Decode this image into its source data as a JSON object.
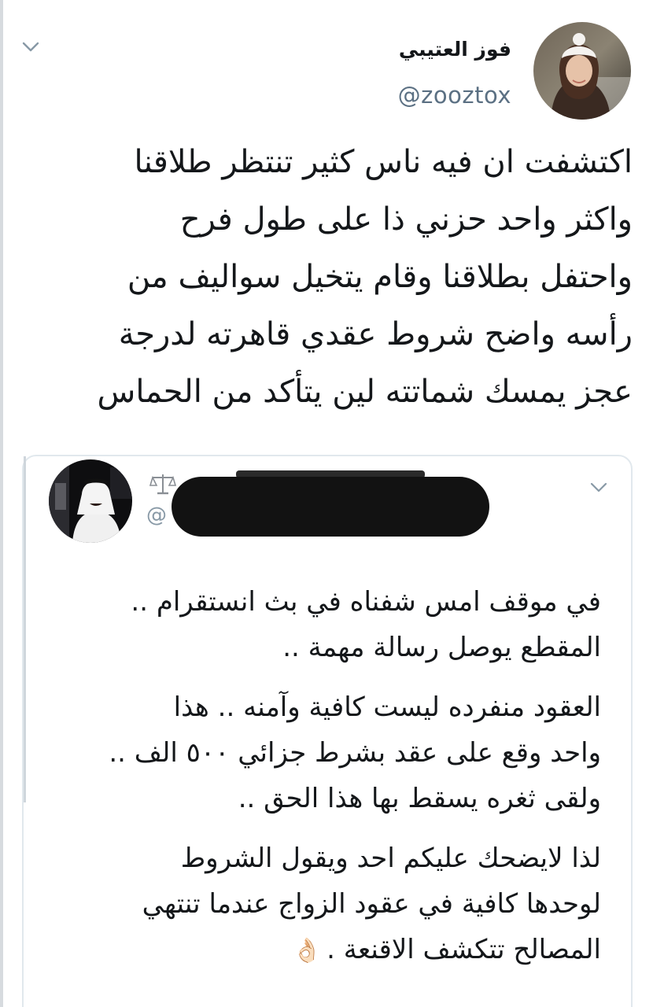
{
  "tweet": {
    "display_name": "فوز العتيبي",
    "handle": "@zooztox",
    "text_lines": [
      "اكتشفت ان فيه ناس كثير تنتظر طلاقنا",
      "واكثر واحد حزني ذا على طول فرح",
      "واحتفل بطلاقنا وقام يتخيل سواليف من",
      "رأسه واضح شروط عقدي قاهرته لدرجة",
      "عجز يمسك شماتته لين يتأكد من الحماس"
    ]
  },
  "quoted_tweet": {
    "handle_prefix": "@",
    "paragraphs": [
      [
        "في موقف امس شفناه في بث انستقرام ..",
        "المقطع يوصل رسالة مهمة .."
      ],
      [
        "العقود منفرده ليست كافية وآمنه .. هذا",
        "واحد وقع على عقد بشرط جزائي ٥٠٠ الف ..",
        "ولقى ثغره يسقط بها هذا الحق .."
      ],
      [
        "لذا لايضحك عليكم احد ويقول الشروط",
        "لوحدها كافية في عقود الزواج عندما تنتهي",
        "المصالح تتكشف الاقنعة ."
      ]
    ],
    "ending_emoji": "👌🏻"
  },
  "colors": {
    "text_primary": "#14171a",
    "text_secondary": "#5b7083",
    "border": "#e1e8ed",
    "redaction": "#121212"
  },
  "icons": [
    "chevron-down-icon",
    "scales-of-justice-icon",
    "ok-hand-emoji"
  ]
}
